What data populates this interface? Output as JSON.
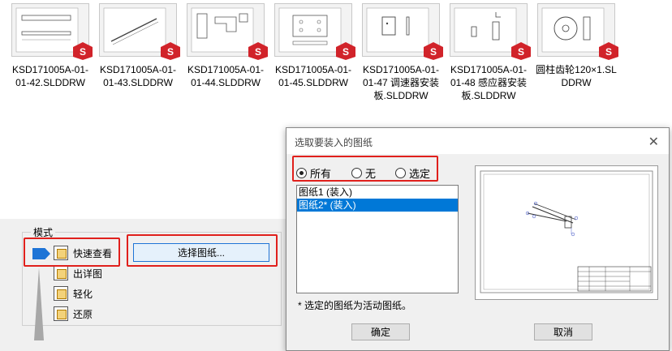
{
  "files": [
    {
      "name": "KSD171005A-01-01-42.SLDDRW",
      "icon": "solidworks-drawing-icon"
    },
    {
      "name": "KSD171005A-01-01-43.SLDDRW",
      "icon": "solidworks-drawing-icon"
    },
    {
      "name": "KSD171005A-01-01-44.SLDDRW",
      "icon": "solidworks-drawing-icon"
    },
    {
      "name": "KSD171005A-01-01-45.SLDDRW",
      "icon": "solidworks-drawing-icon"
    },
    {
      "name": "KSD171005A-01-01-47 调速器安装板.SLDDRW",
      "icon": "solidworks-drawing-icon"
    },
    {
      "name": "KSD171005A-01-01-48 感应器安装板.SLDDRW",
      "icon": "solidworks-drawing-icon"
    },
    {
      "name": "圆柱齿轮120×1.SLDDRW",
      "icon": "solidworks-drawing-icon"
    }
  ],
  "mode_panel": {
    "legend": "模式",
    "items": [
      {
        "label": "快速查看",
        "icon": "quick-view-icon"
      },
      {
        "label": "出详图",
        "icon": "detailing-icon"
      },
      {
        "label": "轻化",
        "icon": "lightweight-icon"
      },
      {
        "label": "还原",
        "icon": "resolved-icon"
      }
    ],
    "select_sheets_button": "选择图纸..."
  },
  "dialog": {
    "title": "选取要装入的图纸",
    "close_icon": "close-icon",
    "radios": [
      {
        "label": "所有",
        "checked": true
      },
      {
        "label": "无",
        "checked": false
      },
      {
        "label": "选定",
        "checked": false
      }
    ],
    "sheets": [
      {
        "label": "图纸1 (装入)",
        "selected": false
      },
      {
        "label": "图纸2* (装入)",
        "selected": true
      }
    ],
    "note": "* 选定的图纸为活动图纸。",
    "ok_button": "确定",
    "cancel_button": "取消"
  },
  "colors": {
    "highlight_red": "#e0201c",
    "selection_blue": "#0078d7",
    "button_focus_blue": "#1e74d6",
    "solidworks_red": "#d1232a"
  }
}
